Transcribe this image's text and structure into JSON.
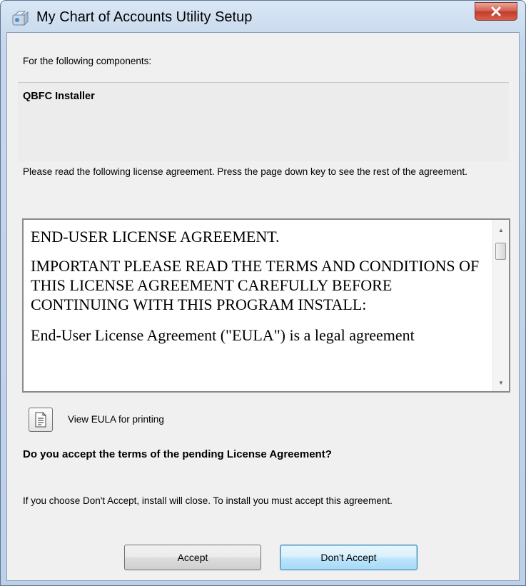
{
  "window": {
    "title": "My Chart of Accounts Utility Setup",
    "close_icon": "close-icon",
    "app_icon": "installer-icon"
  },
  "components": {
    "heading": "For the following components:",
    "items": [
      "QBFC Installer"
    ]
  },
  "instructions": "Please read the following license agreement. Press the page down key to see the rest of the agreement.",
  "eula": {
    "paragraphs": [
      "END-USER LICENSE AGREEMENT.",
      " IMPORTANT PLEASE READ THE TERMS AND CONDITIONS OF THIS LICENSE AGREEMENT CAREFULLY BEFORE CONTINUING WITH THIS PROGRAM INSTALL:",
      "End-User License Agreement (\"EULA\") is a legal agreement"
    ]
  },
  "print": {
    "label": "View EULA for printing",
    "icon": "document-icon"
  },
  "question": "Do you accept the terms of the pending License Agreement?",
  "note": "If you choose Don't Accept, install will close. To install you must accept this agreement.",
  "buttons": {
    "accept": "Accept",
    "dont_accept": "Don't Accept"
  }
}
